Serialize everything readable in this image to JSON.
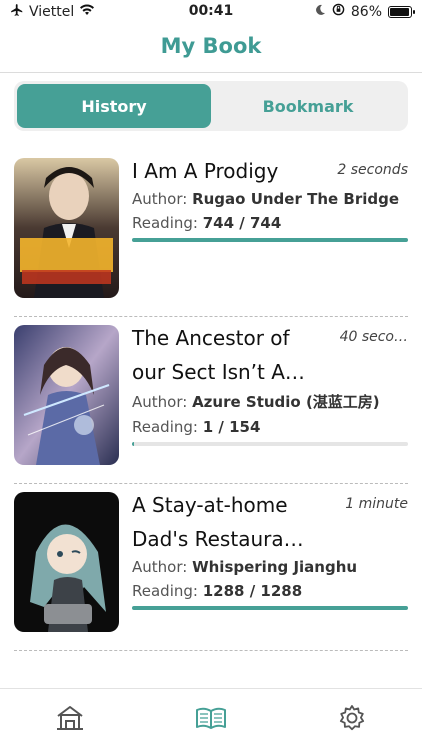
{
  "status_bar": {
    "carrier": "Viettel",
    "time": "00:41",
    "battery": "86%",
    "battery_level": 0.86
  },
  "header": {
    "title": "My Book"
  },
  "segments": [
    {
      "label": "History",
      "active": true
    },
    {
      "label": "Bookmark",
      "active": false
    }
  ],
  "books": [
    {
      "title": "I Am A Prodigy",
      "time": "2 seconds",
      "author_label": "Author:",
      "author": "Rugao Under The Bridge",
      "reading_label": "Reading:",
      "reading": "744 / 744",
      "progress": 1.0
    },
    {
      "title": "The Ancestor of our Sect Isn’t A…",
      "time": "40 seco…",
      "author_label": "Author:",
      "author": "Azure Studio (湛蓝工房)",
      "reading_label": "Reading:",
      "reading": "1 / 154",
      "progress": 0.0065
    },
    {
      "title": "A Stay-at-home Dad's Restaura…",
      "time": "1 minute",
      "author_label": "Author:",
      "author": "Whispering Jianghu",
      "reading_label": "Reading:",
      "reading": "1288 / 1288",
      "progress": 1.0
    }
  ],
  "tabbar": [
    {
      "icon": "home-icon",
      "active": false
    },
    {
      "icon": "book-icon",
      "active": true
    },
    {
      "icon": "settings-gear-icon",
      "active": false
    }
  ],
  "colors": {
    "accent": "#46a096",
    "title": "#3f9b94"
  }
}
